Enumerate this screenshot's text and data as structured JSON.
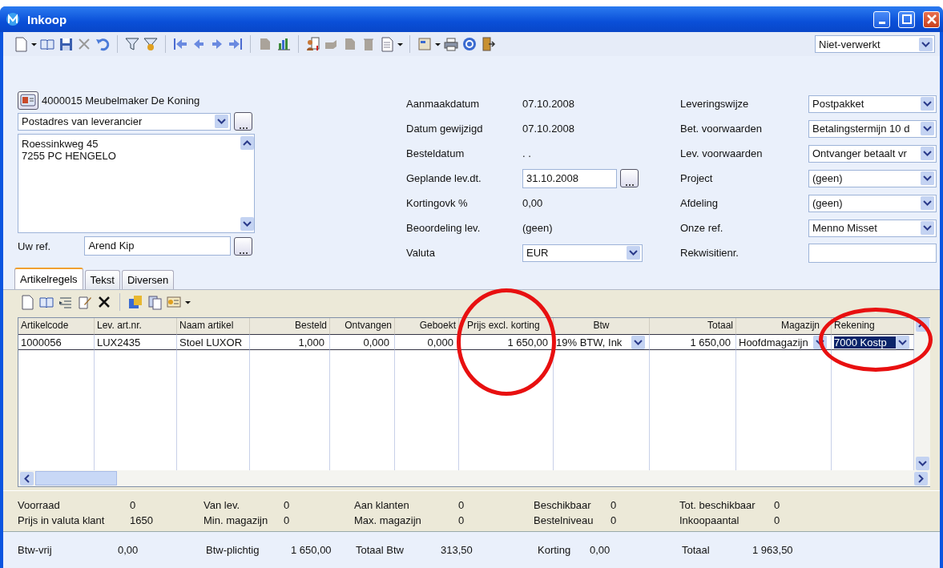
{
  "window": {
    "title": "Inkoop"
  },
  "status_select": {
    "value": "Niet-verwerkt"
  },
  "supplier": {
    "name": "4000015 Meubelmaker De Koning",
    "address_type": "Postadres van leverancier",
    "address_lines": [
      "Roessinkweg 45",
      "7255 PC HENGELO"
    ],
    "ref_label": "Uw ref.",
    "ref_value": "Arend Kip"
  },
  "details": [
    {
      "label": "Aanmaakdatum",
      "value": "07.10.2008",
      "kind": "text"
    },
    {
      "label": "Datum gewijzigd",
      "value": "07.10.2008",
      "kind": "text"
    },
    {
      "label": "Besteldatum",
      "value": ". .",
      "kind": "text"
    },
    {
      "label": "Geplande lev.dt.",
      "value": "31.10.2008",
      "kind": "date"
    },
    {
      "label": "Kortingovk %",
      "value": "0,00",
      "kind": "text"
    },
    {
      "label": "Beoordeling lev.",
      "value": "(geen)",
      "kind": "text"
    },
    {
      "label": "Valuta",
      "value": "EUR",
      "kind": "select"
    }
  ],
  "delivery": [
    {
      "label": "Leveringswijze",
      "value": "Postpakket",
      "kind": "select"
    },
    {
      "label": "Bet. voorwaarden",
      "value": "Betalingstermijn 10 d",
      "kind": "select"
    },
    {
      "label": "Lev. voorwaarden",
      "value": "Ontvanger betaalt vr",
      "kind": "select"
    },
    {
      "label": "Project",
      "value": "(geen)",
      "kind": "select"
    },
    {
      "label": "Afdeling",
      "value": "(geen)",
      "kind": "select"
    },
    {
      "label": "Onze ref.",
      "value": "Menno Misset",
      "kind": "select"
    },
    {
      "label": "Rekwisitienr.",
      "kind": "field"
    }
  ],
  "tabs": [
    {
      "label": "Artikelregels",
      "selected": true
    },
    {
      "label": "Tekst",
      "selected": false
    },
    {
      "label": "Diversen",
      "selected": false
    }
  ],
  "grid": {
    "columns": [
      "Artikelcode",
      "Lev. art.nr.",
      "Naam artikel",
      "Besteld",
      "Ontvangen",
      "Geboekt",
      "Prijs excl. korting",
      "Btw",
      "Totaal",
      "Magazijn",
      "Rekening"
    ],
    "rows": [
      {
        "cells": [
          {
            "text": "1000056",
            "kind": "text",
            "selected": false
          },
          {
            "text": "LUX2435",
            "kind": "text",
            "selected": false
          },
          {
            "text": "Stoel LUXOR",
            "kind": "text",
            "selected": false
          },
          {
            "text": "1,000",
            "kind": "number",
            "selected": false
          },
          {
            "text": "0,000",
            "kind": "number",
            "selected": false
          },
          {
            "text": "0,000",
            "kind": "number",
            "selected": false
          },
          {
            "text": "1 650,00",
            "kind": "number",
            "selected": false
          },
          {
            "text": "19% BTW, Ink",
            "kind": "select",
            "selected": false
          },
          {
            "text": "1 650,00",
            "kind": "number",
            "selected": false
          },
          {
            "text": "Hoofdmagazijn",
            "kind": "select",
            "selected": false
          },
          {
            "text": "7000 Kostp",
            "kind": "select",
            "selected": true
          }
        ]
      }
    ]
  },
  "stock": [
    {
      "label": "Voorraad",
      "value": "0"
    },
    {
      "label": "Van lev.",
      "value": "0"
    },
    {
      "label": "Aan klanten",
      "value": "0"
    },
    {
      "label": "Beschikbaar",
      "value": "0"
    },
    {
      "label": "Tot. beschikbaar",
      "value": "0"
    },
    {
      "label": "Prijs in valuta klant",
      "value": "1650"
    },
    {
      "label": "Min. magazijn",
      "value": "0"
    },
    {
      "label": "Max. magazijn",
      "value": "0"
    },
    {
      "label": "Bestelniveau",
      "value": "0"
    },
    {
      "label": "Inkoopaantal",
      "value": "0"
    }
  ],
  "totals": [
    {
      "label": "Btw-vrij",
      "value": "0,00"
    },
    {
      "label": "Btw-plichtig",
      "value": "1 650,00"
    },
    {
      "label": "Totaal Btw",
      "value": "313,50"
    },
    {
      "label": "Korting",
      "value": "0,00"
    },
    {
      "label": "Totaal",
      "value": "1 963,50"
    }
  ]
}
